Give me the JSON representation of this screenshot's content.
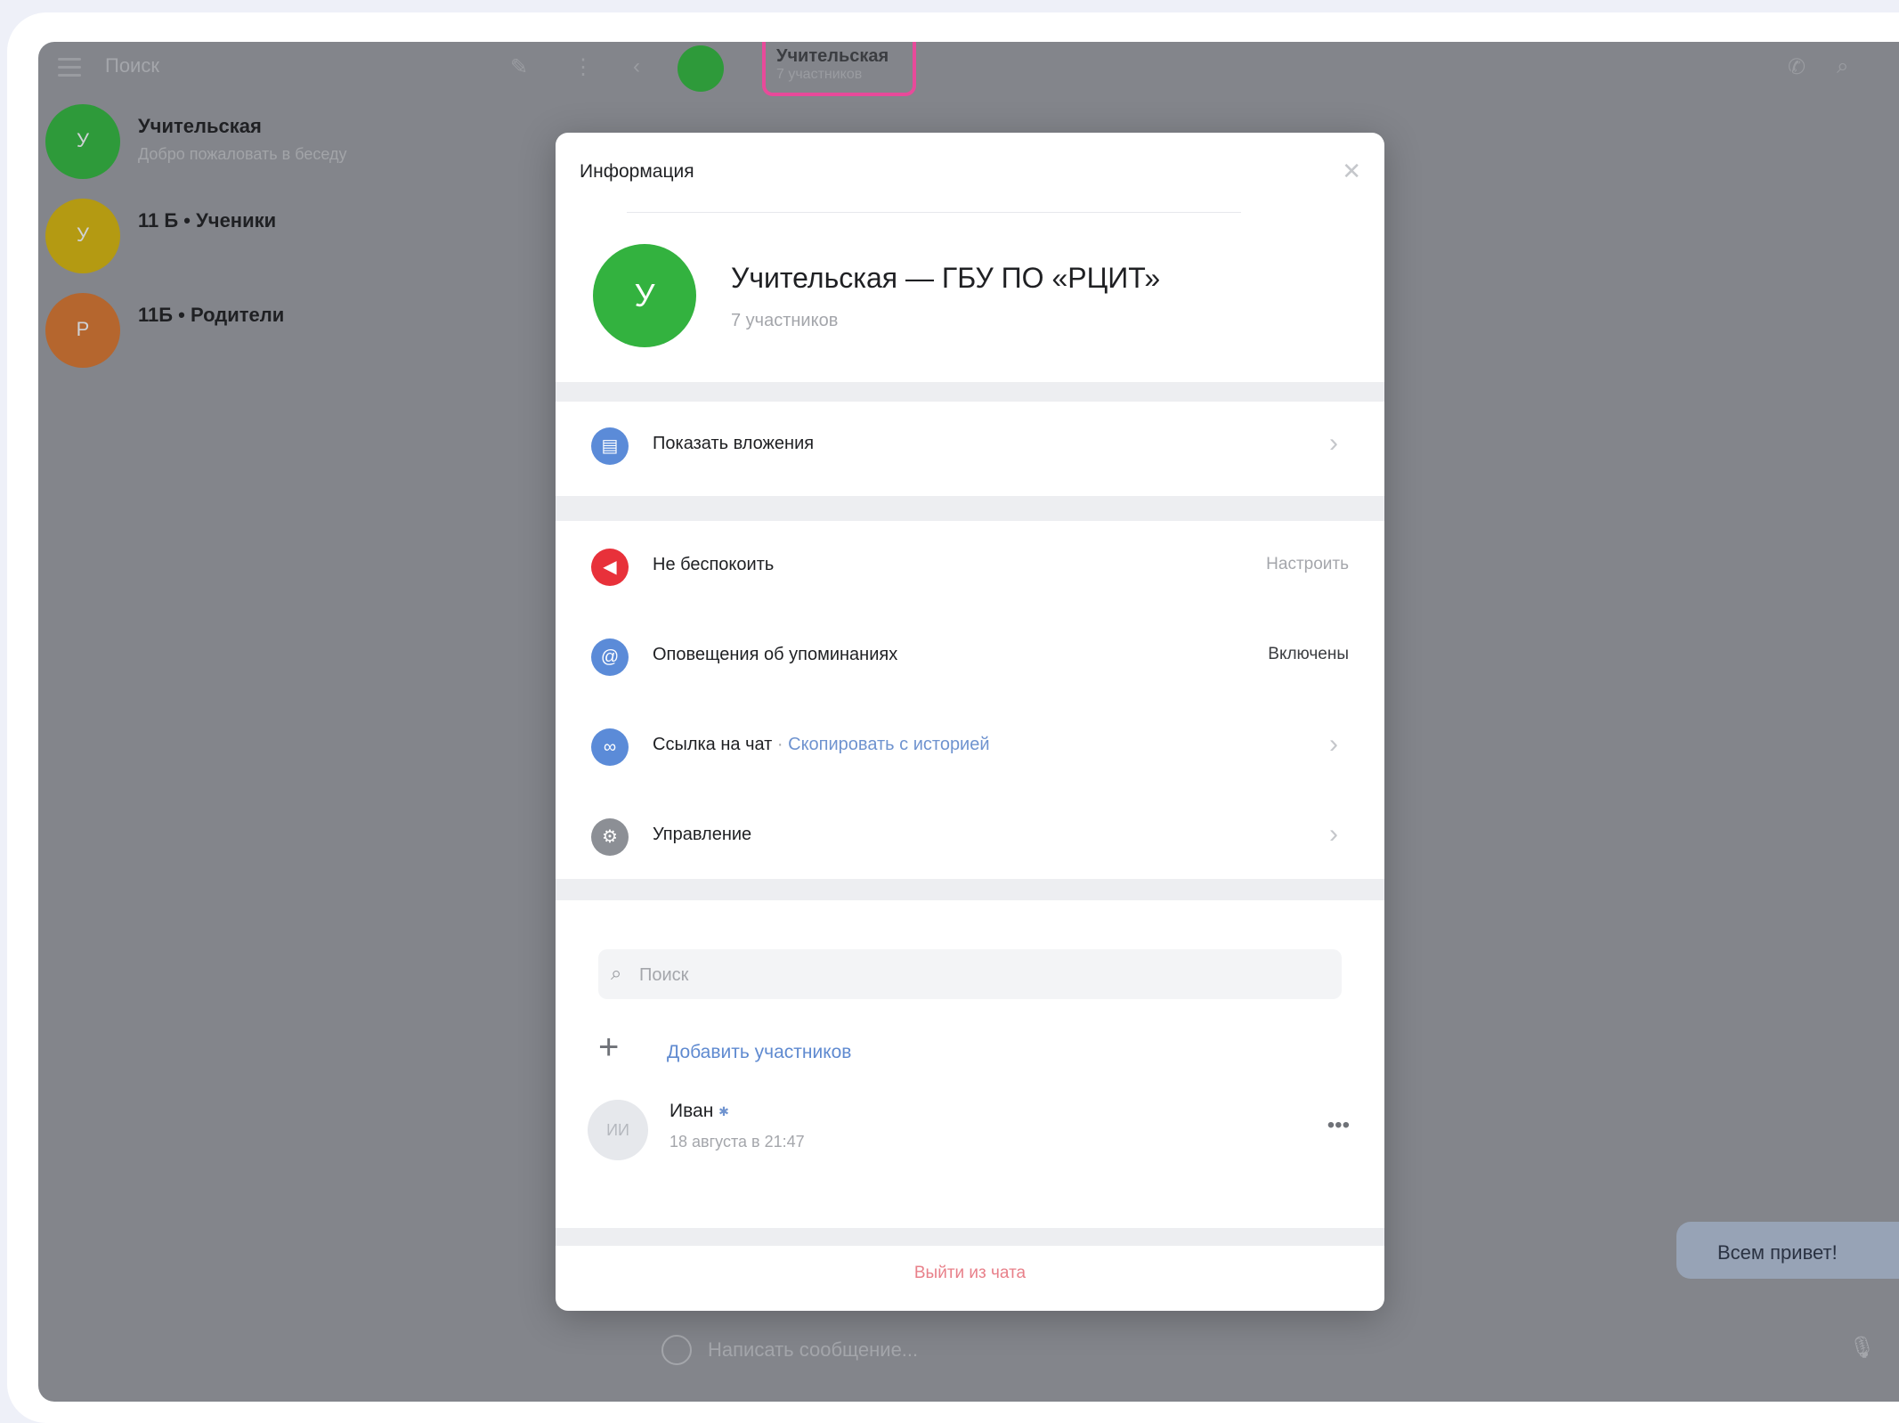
{
  "sidebar": {
    "search_placeholder": "Поиск",
    "chats": [
      {
        "name": "Учительская",
        "preview": "Добро пожаловать в беседу",
        "color": "#2e9a3a",
        "initial": "У"
      },
      {
        "name": "11 Б • Ученики",
        "preview": "",
        "color": "#b49a12",
        "initial": "У"
      },
      {
        "name": "11Б • Родители",
        "preview": "",
        "color": "#b5662e",
        "initial": "Р"
      }
    ]
  },
  "header": {
    "chat_title": "Учительская",
    "chat_subtitle": "7 участников",
    "highlight_color": "#e84a9a"
  },
  "modal": {
    "title": "Информация",
    "close_icon": "close-icon",
    "group": {
      "avatar_letter": "У",
      "name": "Учительская — ГБУ ПО «РЦИТ»",
      "members_count": "7 участников"
    },
    "rows": {
      "attachments": {
        "label": "Показать вложения",
        "icon": "attachments-icon",
        "icon_color": "#5b8bd8"
      },
      "dnd": {
        "label": "Не беспокоить",
        "value": "Настроить",
        "icon": "bell-off-icon",
        "icon_color": "#e8313a"
      },
      "mentions": {
        "label": "Оповещения об упоминаниях",
        "value": "Включены",
        "icon": "at-icon",
        "icon_color": "#5b8bd8"
      },
      "link": {
        "label": "Ссылка на чат",
        "sep": " · ",
        "link_text": "Скопировать с историей",
        "icon": "link-icon",
        "icon_color": "#5b8bd8"
      },
      "manage": {
        "label": "Управление",
        "icon": "gear-icon",
        "icon_color": "#8c8f95"
      }
    },
    "search_placeholder": "Поиск",
    "add_members": "Добавить участников",
    "member": {
      "initials": "ИИ",
      "name": "Иван",
      "last_seen": "18 августа в 21:47"
    },
    "leave": "Выйти из чата"
  },
  "composer": {
    "placeholder": "Написать сообщение..."
  },
  "bubble": {
    "text": "Всем привет!"
  }
}
